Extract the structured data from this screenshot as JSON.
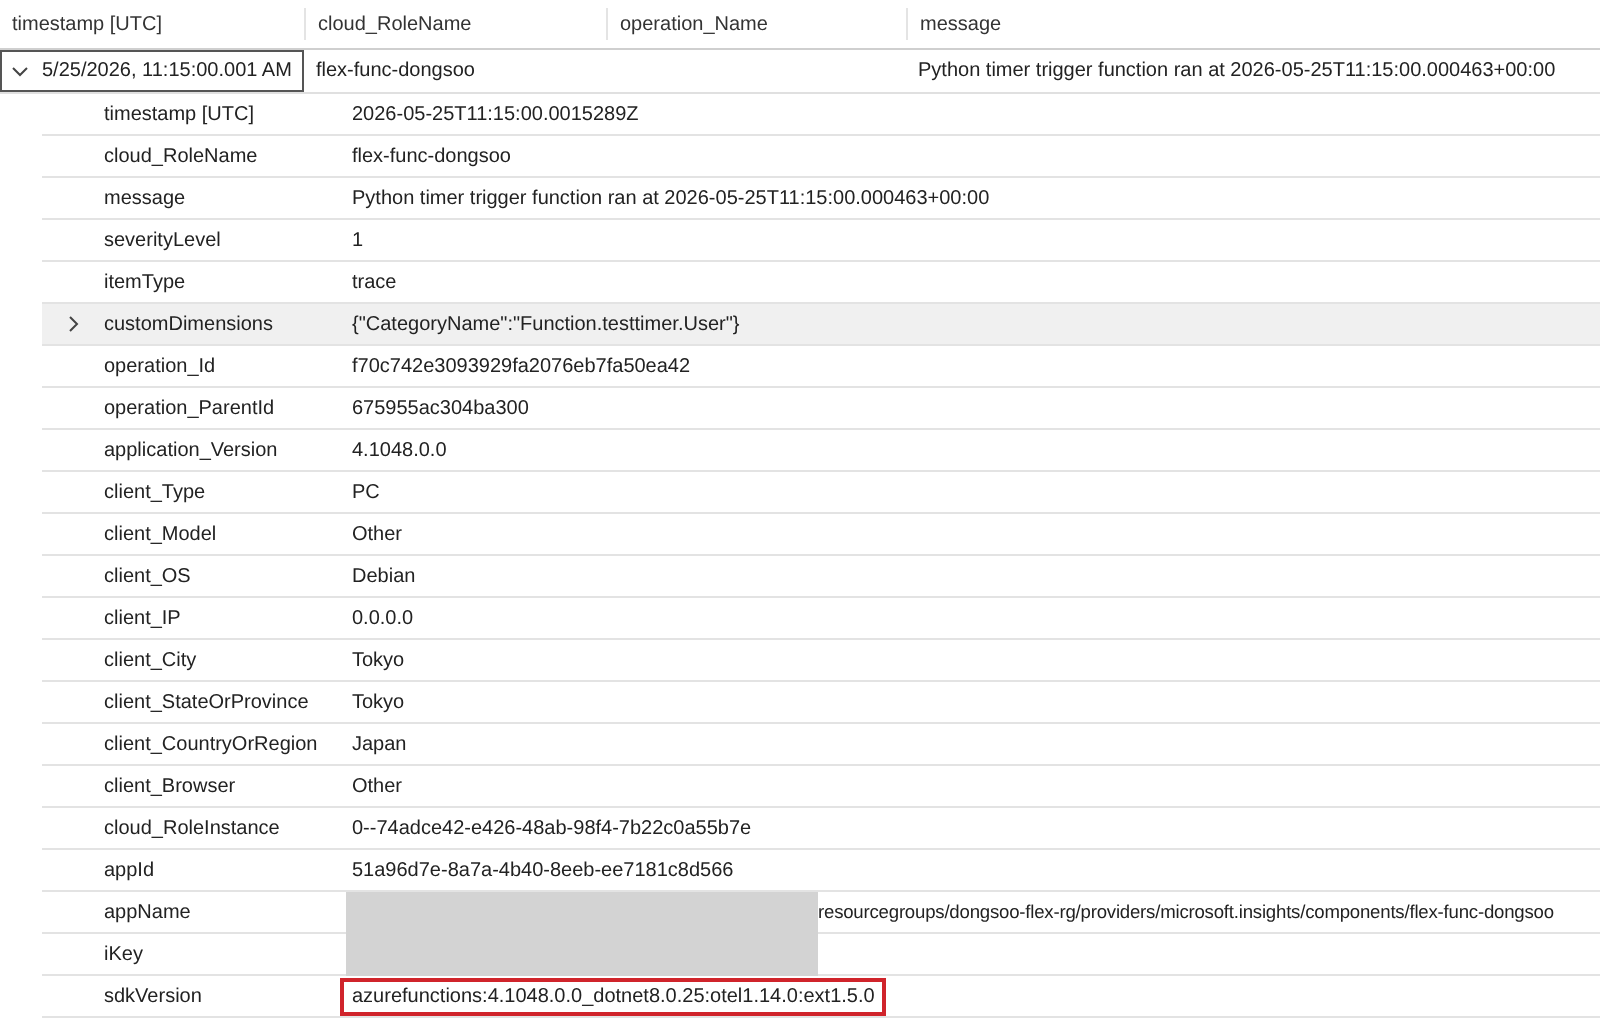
{
  "columns": [
    "timestamp [UTC]",
    "cloud_RoleName",
    "operation_Name",
    "message"
  ],
  "record": {
    "expanded": true,
    "focused": true,
    "cells": [
      "5/25/2026, 11:15:00.001 AM",
      "flex-func-dongsoo",
      "",
      "Python timer trigger function ran at 2026-05-25T11:15:00.000463+00:00"
    ]
  },
  "details": [
    {
      "key": "timestamp [UTC]",
      "value": "2026-05-25T11:15:00.0015289Z",
      "kind": "plain",
      "selected": false,
      "redacted": false,
      "highlighted": false
    },
    {
      "key": "cloud_RoleName",
      "value": "flex-func-dongsoo",
      "kind": "plain",
      "selected": false,
      "redacted": false,
      "highlighted": false
    },
    {
      "key": "message",
      "value": "Python timer trigger function ran at 2026-05-25T11:15:00.000463+00:00",
      "kind": "plain",
      "selected": false,
      "redacted": false,
      "highlighted": false
    },
    {
      "key": "severityLevel",
      "value": "1",
      "kind": "plain",
      "selected": false,
      "redacted": false,
      "highlighted": false
    },
    {
      "key": "itemType",
      "value": "trace",
      "kind": "plain",
      "selected": false,
      "redacted": false,
      "highlighted": false
    },
    {
      "key": "customDimensions",
      "value": "{\"CategoryName\":\"Function.testtimer.User\"}",
      "kind": "expandable",
      "expanded": false,
      "selected": true,
      "redacted": false,
      "highlighted": false
    },
    {
      "key": "operation_Id",
      "value": "f70c742e3093929fa2076eb7fa50ea42",
      "kind": "plain",
      "selected": false,
      "redacted": false,
      "highlighted": false
    },
    {
      "key": "operation_ParentId",
      "value": "675955ac304ba300",
      "kind": "plain",
      "selected": false,
      "redacted": false,
      "highlighted": false
    },
    {
      "key": "application_Version",
      "value": "4.1048.0.0",
      "kind": "plain",
      "selected": false,
      "redacted": false,
      "highlighted": false
    },
    {
      "key": "client_Type",
      "value": "PC",
      "kind": "plain",
      "selected": false,
      "redacted": false,
      "highlighted": false
    },
    {
      "key": "client_Model",
      "value": "Other",
      "kind": "plain",
      "selected": false,
      "redacted": false,
      "highlighted": false
    },
    {
      "key": "client_OS",
      "value": "Debian",
      "kind": "plain",
      "selected": false,
      "redacted": false,
      "highlighted": false
    },
    {
      "key": "client_IP",
      "value": "0.0.0.0",
      "kind": "plain",
      "selected": false,
      "redacted": false,
      "highlighted": false
    },
    {
      "key": "client_City",
      "value": "Tokyo",
      "kind": "plain",
      "selected": false,
      "redacted": false,
      "highlighted": false
    },
    {
      "key": "client_StateOrProvince",
      "value": "Tokyo",
      "kind": "plain",
      "selected": false,
      "redacted": false,
      "highlighted": false
    },
    {
      "key": "client_CountryOrRegion",
      "value": "Japan",
      "kind": "plain",
      "selected": false,
      "redacted": false,
      "highlighted": false
    },
    {
      "key": "client_Browser",
      "value": "Other",
      "kind": "plain",
      "selected": false,
      "redacted": false,
      "highlighted": false
    },
    {
      "key": "cloud_RoleInstance",
      "value": "0--74adce42-e426-48ab-98f4-7b22c0a55b7e",
      "kind": "plain",
      "selected": false,
      "redacted": false,
      "highlighted": false
    },
    {
      "key": "appId",
      "value": "51a96d7e-8a7a-4b40-8eeb-ee7181c8d566",
      "kind": "plain",
      "selected": false,
      "redacted": false,
      "highlighted": false
    },
    {
      "key": "appName",
      "value": "resourcegroups/dongsoo-flex-rg/providers/microsoft.insights/components/flex-func-dongsoo",
      "kind": "plain",
      "selected": false,
      "redacted": true,
      "highlighted": false
    },
    {
      "key": "iKey",
      "kind": "plain",
      "selected": false,
      "redacted": true,
      "highlighted": false
    },
    {
      "key": "sdkVersion",
      "value": "azurefunctions:4.1048.0.0_dotnet8.0.25:otel1.14.0:ext1.5.0",
      "kind": "plain",
      "selected": false,
      "redacted": false,
      "highlighted": true
    }
  ]
}
